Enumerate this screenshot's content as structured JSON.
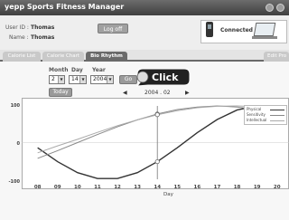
{
  "app": {
    "title": "yepp Sports Fitness Manager"
  },
  "user": {
    "id_label": "User ID :",
    "id_value": "Thomas",
    "name_label": "Name :",
    "name_value": "Thomas",
    "logoff_label": "Log off"
  },
  "connection": {
    "status": "Connected"
  },
  "tabs": [
    {
      "label": "Calorie List",
      "active": false
    },
    {
      "label": "Calorie Chart",
      "active": false
    },
    {
      "label": "Bio Rhythm",
      "active": true
    },
    {
      "label": "Edit Pro",
      "active": false
    }
  ],
  "date_picker": {
    "month_label": "Month",
    "day_label": "Day",
    "year_label": "Year",
    "month_value": "2",
    "day_value": "14",
    "year_value": "2004",
    "go_label": "Go",
    "today_label": "Today",
    "current_month": "2004 . 02",
    "prev_arrow": "◀",
    "next_arrow": "▶"
  },
  "callout": {
    "text": "Click"
  },
  "chart_data": {
    "type": "line",
    "x": [
      8,
      9,
      10,
      11,
      12,
      13,
      14,
      15,
      16,
      17,
      18,
      19,
      20
    ],
    "x_tick_labels": [
      "08",
      "09",
      "10",
      "11",
      "12",
      "13",
      "14",
      "15",
      "16",
      "17",
      "18",
      "19",
      "20"
    ],
    "xlabel": "Day",
    "y_tick_labels": [
      "100",
      "0",
      "-100"
    ],
    "ylim": [
      -100,
      100
    ],
    "marker_day": 14,
    "series": [
      {
        "name": "Physical",
        "color": "#333333",
        "values": [
          -14,
          -52,
          -82,
          -98,
          -98,
          -82,
          -52,
          -14,
          27,
          63,
          89,
          100,
          94
        ]
      },
      {
        "name": "Sensitivity",
        "color": "#888888",
        "values": [
          -43,
          -22,
          0,
          22,
          43,
          62,
          78,
          90,
          97,
          100,
          97,
          90,
          78
        ]
      },
      {
        "name": "Intellectual",
        "color": "#aaaaaa",
        "values": [
          -28,
          -9,
          9,
          28,
          46,
          62,
          76,
          87,
          95,
          99,
          100,
          98,
          92
        ]
      }
    ],
    "grid": false,
    "legend_position": "top-right"
  }
}
